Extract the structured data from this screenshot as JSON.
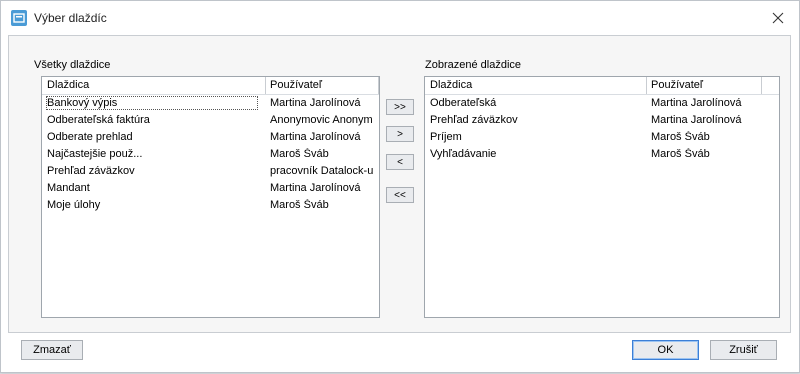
{
  "window": {
    "title": "Výber dlaždíc"
  },
  "all_tiles": {
    "label": "Všetky dlaždice",
    "col_tile": "Dlaždica",
    "col_user": "Používateľ",
    "rows": [
      {
        "tile": "Bankový výpis",
        "user": "Martina Jarolínová"
      },
      {
        "tile": "Odberateľská faktúra",
        "user": "Anonymovic Anonym"
      },
      {
        "tile": "Odberate prehlad",
        "user": "Martina Jarolínová"
      },
      {
        "tile": "Najčastejšie použ...",
        "user": "Maroš Šváb"
      },
      {
        "tile": "Prehľad záväzkov",
        "user": "pracovník Datalock-u"
      },
      {
        "tile": "Mandant",
        "user": "Martina Jarolínová"
      },
      {
        "tile": "Moje úlohy",
        "user": "Maroš Šváb"
      }
    ]
  },
  "shown_tiles": {
    "label": "Zobrazené dlaždice",
    "col_tile": "Dlaždica",
    "col_user": "Používateľ",
    "rows": [
      {
        "tile": "Odberateľská",
        "user": "Martina Jarolínová"
      },
      {
        "tile": "Prehľad záväzkov",
        "user": "Martina Jarolínová"
      },
      {
        "tile": "Príjem",
        "user": "Maroš Šváb"
      },
      {
        "tile": "Vyhľadávanie",
        "user": "Maroš Šváb"
      }
    ]
  },
  "transfer": {
    "add_all": ">>",
    "add": ">",
    "remove": "<",
    "remove_all": "<<"
  },
  "footer": {
    "delete_label": "Zmazať",
    "ok_label": "OK",
    "cancel_label": "Zrušiť"
  },
  "icons": {
    "app": "app-window-icon",
    "close": "close-icon"
  }
}
